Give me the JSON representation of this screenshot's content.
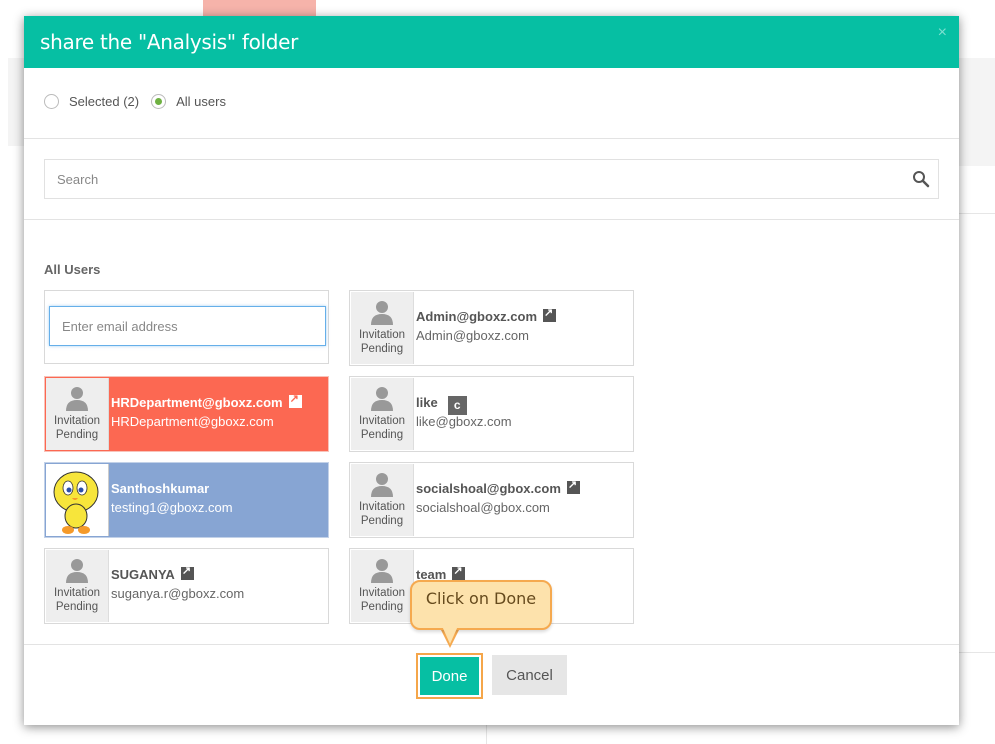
{
  "dialog": {
    "title": "share the \"Analysis\" folder",
    "close_glyph": "×"
  },
  "scope": {
    "options": [
      {
        "label": "Selected (2)",
        "checked": false
      },
      {
        "label": "All users",
        "checked": true
      }
    ]
  },
  "search": {
    "placeholder": "Search"
  },
  "section": {
    "title": "All Users"
  },
  "email_input": {
    "placeholder": "Enter email address",
    "value": ""
  },
  "avatar_caption": {
    "line1": "Invitation",
    "line2": "Pending"
  },
  "users": [
    {
      "name": "HRDepartment@gboxz.com",
      "email": "HRDepartment@gboxz.com",
      "state": "selected-red",
      "icon": "external-link-icon"
    },
    {
      "name": "Santhoshkumar",
      "email": "testing1@gboxz.com",
      "state": "selected-blue",
      "avatar": "tweety-bird"
    },
    {
      "name": "SUGANYA",
      "email": "suganya.r@gboxz.com",
      "icon": "external-link-icon"
    },
    {
      "name": "Admin@gboxz.com",
      "email": "Admin@gboxz.com",
      "icon": "external-link-icon"
    },
    {
      "name": "like",
      "email": "like@gboxz.com",
      "badge": "c"
    },
    {
      "name": "socialshoal@gbox.com",
      "email": "socialshoal@gbox.com",
      "icon": "external-link-icon"
    },
    {
      "name": "team",
      "email": "",
      "icon": "external-link-icon"
    }
  ],
  "buttons": {
    "done": "Done",
    "cancel": "Cancel"
  },
  "callout": {
    "text": "Click on Done"
  },
  "colors": {
    "header": "#06bfa3",
    "selected_red": "#fc6852",
    "selected_blue": "#87a5d3",
    "callout_bg": "#fde2ac",
    "callout_border": "#f5a94f"
  }
}
